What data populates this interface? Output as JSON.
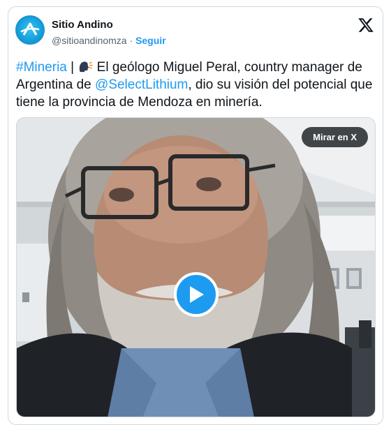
{
  "account": {
    "name": "Sitio Andino",
    "handle": "@sitioandinomza",
    "separator": "·",
    "follow_label": "Seguir",
    "avatar_icon": "sitio-andino-logo-icon",
    "brand_color": "#1d9bf0"
  },
  "platform_icon": "x-logo-icon",
  "tweet": {
    "hashtag": "#Mineria",
    "pipe": "|",
    "emoji_icon": "speaking-head-icon",
    "text_part1": "El geólogo Miguel Peral, country manager de Argentina de",
    "mention": "@SelectLithium",
    "text_part2": ", dio su visión del potencial que tiene la provincia de Mendoza en minería."
  },
  "media": {
    "type": "video",
    "watch_label": "Mirar en X",
    "play_icon": "play-icon"
  }
}
